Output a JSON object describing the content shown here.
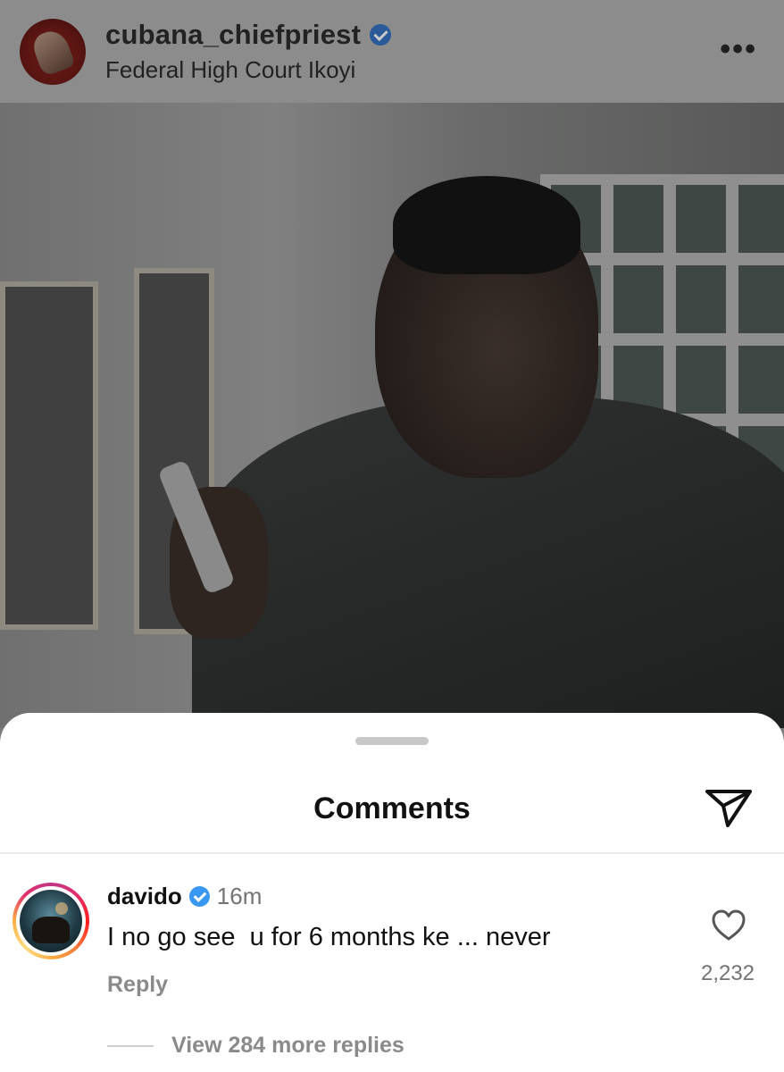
{
  "post": {
    "username": "cubana_chiefpriest",
    "location": "Federal High Court Ikoyi",
    "more_icon": "more-horizontal-icon",
    "more_glyph": "•••"
  },
  "sheet": {
    "title": "Comments",
    "send_icon": "send-icon"
  },
  "comment": {
    "username": "davido",
    "time": "16m",
    "text": "I no go see  u for 6 months ke ... never",
    "reply_label": "Reply",
    "like_count": "2,232",
    "view_replies": "View 284 more replies"
  },
  "colors": {
    "verified_badge": "#3897f0",
    "secondary_text": "#737373"
  }
}
